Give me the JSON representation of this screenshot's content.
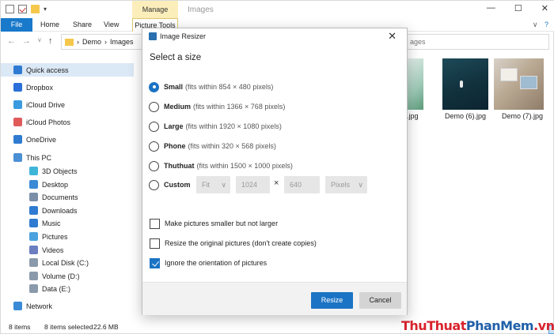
{
  "window": {
    "title": "Images",
    "context_tab": "Manage",
    "controls": [
      "—",
      "☐",
      "✕"
    ]
  },
  "ribbon": {
    "tabs": [
      "File",
      "Home",
      "Share",
      "View",
      "Picture Tools"
    ],
    "collapse": "∨",
    "help": "?"
  },
  "address": {
    "path": [
      "Demo",
      "Images"
    ],
    "search_placeholder": "ages"
  },
  "sidebar": {
    "items": [
      {
        "label": "Quick access",
        "icon": "star-icon",
        "color": "#2f7bd1"
      },
      {
        "label": "Dropbox",
        "icon": "dropbox-icon",
        "color": "#2b6fd8"
      },
      {
        "label": "iCloud Drive",
        "icon": "icloud-icon",
        "color": "#3a9be0"
      },
      {
        "label": "iCloud Photos",
        "icon": "photos-icon",
        "color": "#e05a5a"
      },
      {
        "label": "OneDrive",
        "icon": "onedrive-icon",
        "color": "#2f7bd1"
      },
      {
        "label": "This PC",
        "icon": "pc-icon",
        "color": "#4b8fd4"
      },
      {
        "label": "3D Objects",
        "icon": "cube-icon",
        "color": "#3fb6d8"
      },
      {
        "label": "Desktop",
        "icon": "desktop-icon",
        "color": "#3a8ad6"
      },
      {
        "label": "Documents",
        "icon": "documents-icon",
        "color": "#7a8ea8"
      },
      {
        "label": "Downloads",
        "icon": "downloads-icon",
        "color": "#2f7bd1"
      },
      {
        "label": "Music",
        "icon": "music-icon",
        "color": "#2f7bd1"
      },
      {
        "label": "Pictures",
        "icon": "pictures-icon",
        "color": "#4aa3df"
      },
      {
        "label": "Videos",
        "icon": "videos-icon",
        "color": "#6a7ec0"
      },
      {
        "label": "Local Disk (C:)",
        "icon": "disk-icon",
        "color": "#8a9aab"
      },
      {
        "label": "Volume (D:)",
        "icon": "disk-icon",
        "color": "#8a9aab"
      },
      {
        "label": "Data (E:)",
        "icon": "disk-icon",
        "color": "#8a9aab"
      },
      {
        "label": "Network",
        "icon": "network-icon",
        "color": "#3a8ad6"
      }
    ]
  },
  "files": [
    {
      "label": "5).jpg"
    },
    {
      "label": "Demo (6).jpg"
    },
    {
      "label": "Demo (7).jpg"
    }
  ],
  "status": {
    "items": "8 items",
    "selected": "8 items selected",
    "size": "22.6 MB"
  },
  "watermark": {
    "part1": "ThuThuat",
    "part2": "PhanMem",
    "part3": ".vn"
  },
  "dialog": {
    "title": "Image Resizer",
    "heading": "Select a size",
    "sizes": [
      {
        "name": "Small",
        "desc": "(fits within 854 × 480 pixels)",
        "selected": true
      },
      {
        "name": "Medium",
        "desc": "(fits within 1366 × 768 pixels)",
        "selected": false
      },
      {
        "name": "Large",
        "desc": "(fits within 1920 × 1080 pixels)",
        "selected": false
      },
      {
        "name": "Phone",
        "desc": "(fits within 320 × 568 pixels)",
        "selected": false
      },
      {
        "name": "Thuthuat",
        "desc": "(fits within 1500 × 1000 pixels)",
        "selected": false
      }
    ],
    "custom": {
      "label": "Custom",
      "fit": "Fit",
      "width": "1024",
      "times": "×",
      "height": "640",
      "unit": "Pixels"
    },
    "options": [
      {
        "label": "Make pictures smaller but not larger",
        "checked": false
      },
      {
        "label": "Resize the original pictures (don't create copies)",
        "checked": false
      },
      {
        "label": "Ignore the orientation of pictures",
        "checked": true
      }
    ],
    "resize_label": "Resize",
    "cancel_label": "Cancel"
  },
  "colors": {
    "accent": "#1a73c4",
    "file_tab": "#1979ca",
    "manage_tab": "#fbeebb",
    "sidebar_active": "#dbe8f6",
    "watermark_red": "#d9232d",
    "watermark_blue": "#1f5fa8"
  }
}
